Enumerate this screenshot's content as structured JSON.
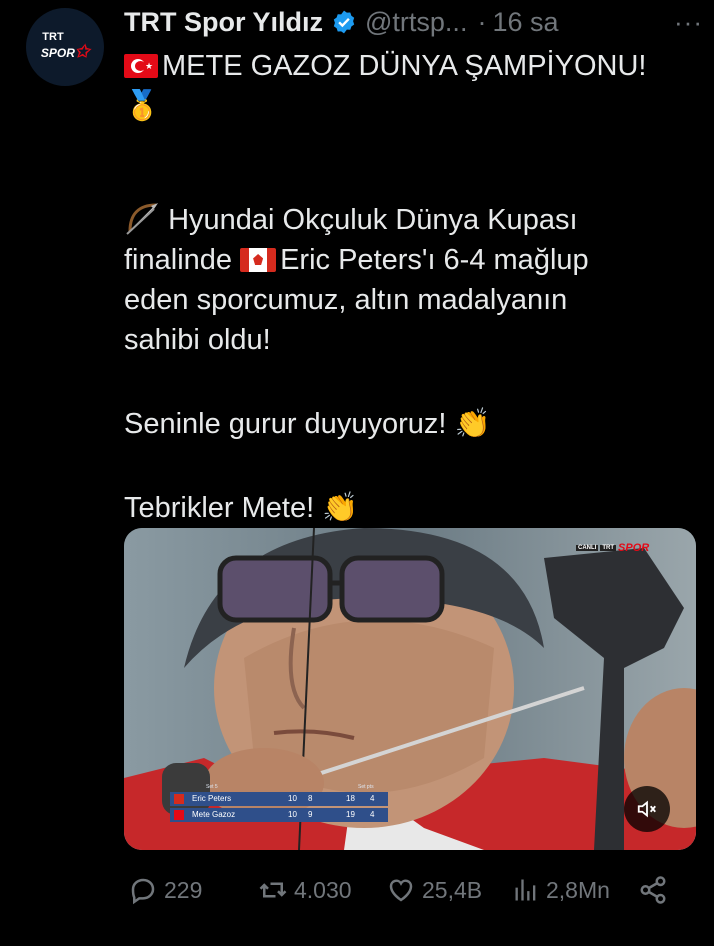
{
  "account": {
    "name": "TRT Spor Yıldız",
    "handle": "@trtsp...",
    "separator": "·",
    "time": "16 sa",
    "more": "···",
    "avatar_top": "TRT",
    "avatar_main": "SPOR"
  },
  "post": {
    "line1": "METE GAZOZ DÜNYA ŞAMPİYONU!",
    "line2": "🥇",
    "line3": "Hyundai Okçuluk Dünya Kupası",
    "line4a": "finalinde ",
    "line4b": "Eric Peters'ı 6-4 mağlup",
    "line5": "eden sporcumuz, altın madalyanın",
    "line6": "sahibi oldu!",
    "line7": "Seninle gurur duyuyoruz! 👏",
    "line8": "Tebrikler Mete! 👏"
  },
  "media": {
    "broadcaster": "TRT",
    "broadcaster_accent": "SPOR",
    "live_tag": "CANLI",
    "scoreboard": {
      "set_label": "Set 5",
      "setpts_label": "Set pts",
      "rows": [
        {
          "name": "Eric Peters",
          "a": "10",
          "b": "8",
          "total": "18",
          "setpts": "4"
        },
        {
          "name": "Mete Gazoz",
          "a": "10",
          "b": "9",
          "total": "19",
          "setpts": "4"
        }
      ]
    }
  },
  "actions": {
    "replies": "229",
    "reposts": "4.030",
    "likes": "25,4B",
    "views": "2,8Mn"
  },
  "colors": {
    "background": "#000000",
    "text": "#e7e9ea",
    "muted": "#71767b",
    "verified": "#1d9bf0"
  }
}
